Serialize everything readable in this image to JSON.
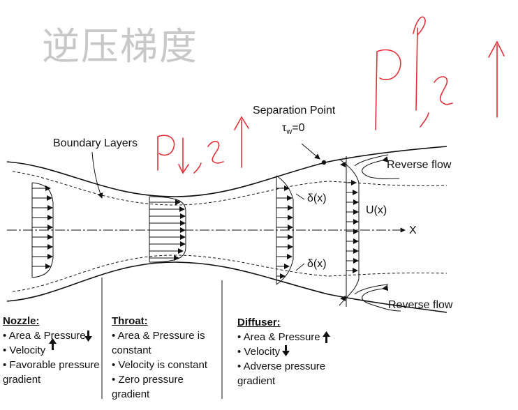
{
  "overlay_title": "逆压梯度",
  "handwritten": {
    "top_right": "P↑, v↑",
    "mid": "P↓, v↑"
  },
  "labels": {
    "separation_point": "Separation Point",
    "tau": "τ",
    "tau_sub": "w",
    "tau_rest": "=0",
    "boundary_layers": "Boundary Layers",
    "reverse_flow_top": "Reverse flow",
    "reverse_flow_bottom": "Reverse flow",
    "delta_top": "δ(x)",
    "delta_bottom": "δ(x)",
    "u_x": "U(x)",
    "x_axis": "X"
  },
  "sections": {
    "nozzle": {
      "heading": "Nozzle:",
      "lines": [
        "• Area & Pressure",
        "• Velocity",
        "• Favorable pressure",
        "gradient"
      ]
    },
    "throat": {
      "heading": "Throat:",
      "lines": [
        "• Area & Pressure is",
        "constant",
        "• Velocity is constant",
        "• Zero pressure",
        "gradient"
      ]
    },
    "diffuser": {
      "heading": "Diffuser:",
      "lines": [
        "• Area & Pressure",
        "• Velocity",
        "• Adverse pressure",
        "gradient"
      ]
    }
  },
  "colors": {
    "ink": "#111111",
    "handwriting": "#e0303a",
    "watermark": "#c8c8c8"
  }
}
